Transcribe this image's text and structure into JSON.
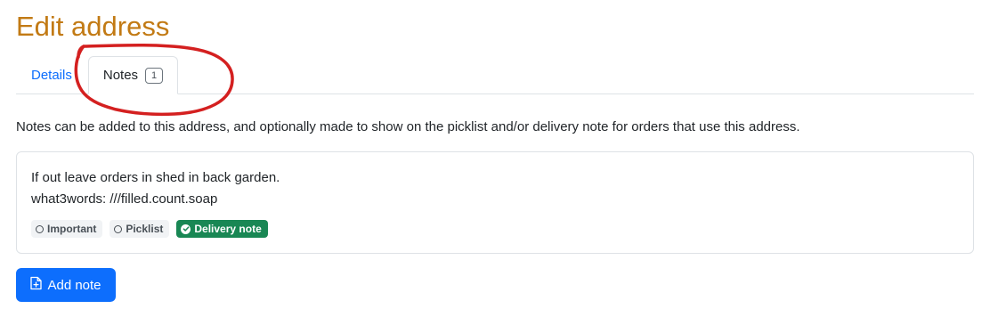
{
  "page_title": "Edit address",
  "tabs": [
    {
      "label": "Details",
      "active": false
    },
    {
      "label": "Notes",
      "active": true,
      "badge": "1"
    }
  ],
  "intro_text": "Notes can be added to this address, and optionally made to show on the picklist and/or delivery note for orders that use this address.",
  "note": {
    "line1": "If out leave orders in shed in back garden.",
    "line2": "what3words: ///filled.count.soap",
    "flags": [
      {
        "label": "Important",
        "checked": false
      },
      {
        "label": "Picklist",
        "checked": false
      },
      {
        "label": "Delivery note",
        "checked": true
      }
    ]
  },
  "add_note_label": "Add note",
  "colors": {
    "title": "#c27a14",
    "link": "#0d6efd",
    "primary": "#0d6efd",
    "success": "#198754",
    "annotation": "#d42020"
  }
}
